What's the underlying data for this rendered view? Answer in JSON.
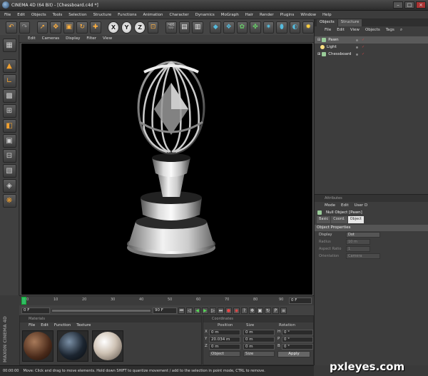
{
  "window": {
    "title": "CINEMA 4D (64 Bit) - [Chessboard.c4d *]"
  },
  "menubar": [
    "File",
    "Edit",
    "Objects",
    "Tools",
    "Selection",
    "Structure",
    "Functions",
    "Animation",
    "Character",
    "Dynamics",
    "MoGraph",
    "Hair",
    "Render",
    "Plugins",
    "Window",
    "Help"
  ],
  "toolbar": {
    "axis_x": "X",
    "axis_y": "Y",
    "axis_z": "Z"
  },
  "viewport": {
    "menu": [
      "Edit",
      "Cameras",
      "Display",
      "Filter",
      "View"
    ]
  },
  "timeline": {
    "ticks": [
      "0",
      "10",
      "20",
      "30",
      "40",
      "50",
      "60",
      "70",
      "80",
      "90"
    ],
    "current_frame": "0 F"
  },
  "playbar": {
    "start": "0 F",
    "end": "90 F"
  },
  "materials": {
    "header": "Materials",
    "menu": [
      "File",
      "Edit",
      "Function",
      "Texture"
    ],
    "swatches": [
      "dark-wood",
      "dark-glass",
      "light-marble"
    ]
  },
  "coordinates": {
    "header": "Coordinates",
    "columns": [
      "Position",
      "Size",
      "Rotation"
    ],
    "rows": [
      {
        "axis": "X",
        "pos": "0 m",
        "size": "0 m",
        "rot_axis": "H",
        "rot": "0 °"
      },
      {
        "axis": "Y",
        "pos": "20.034 m",
        "size": "0 m",
        "rot_axis": "P",
        "rot": "0 °"
      },
      {
        "axis": "Z",
        "pos": "0 m",
        "size": "0 m",
        "rot_axis": "B",
        "rot": "0 °"
      }
    ],
    "mode_object": "Object",
    "mode_size": "Size",
    "apply": "Apply"
  },
  "brand": "MAXON CINEMA 4D",
  "status": {
    "time": "00:00:00",
    "message": "Move: Click and drag to move elements. Hold down SHIFT to quantize movement / add to the selection in point mode, CTRL to remove."
  },
  "objects_panel": {
    "tabs": [
      "Objects",
      "Structure"
    ],
    "menu": [
      "File",
      "Edit",
      "View",
      "Objects",
      "Tags"
    ],
    "tree": [
      {
        "name": "Pawn",
        "selected": true
      },
      {
        "name": "Light",
        "selected": false
      },
      {
        "name": "Chessboard",
        "selected": false
      }
    ]
  },
  "attributes": {
    "header": "Attributes",
    "menu": [
      "Mode",
      "Edit",
      "User D"
    ],
    "object": "Null Object [Pawn]",
    "tabs": [
      "Basic",
      "Coord.",
      "Object"
    ],
    "section": "Object Properties",
    "fields": [
      {
        "label": "Display",
        "value": "Dot",
        "dim": false
      },
      {
        "label": "Radius",
        "value": "10 m",
        "dim": true
      },
      {
        "label": "Aspect Ratio",
        "value": "1",
        "dim": true
      },
      {
        "label": "Orientation",
        "value": "Camera",
        "dim": true
      }
    ]
  },
  "watermark": "pxleyes.com"
}
